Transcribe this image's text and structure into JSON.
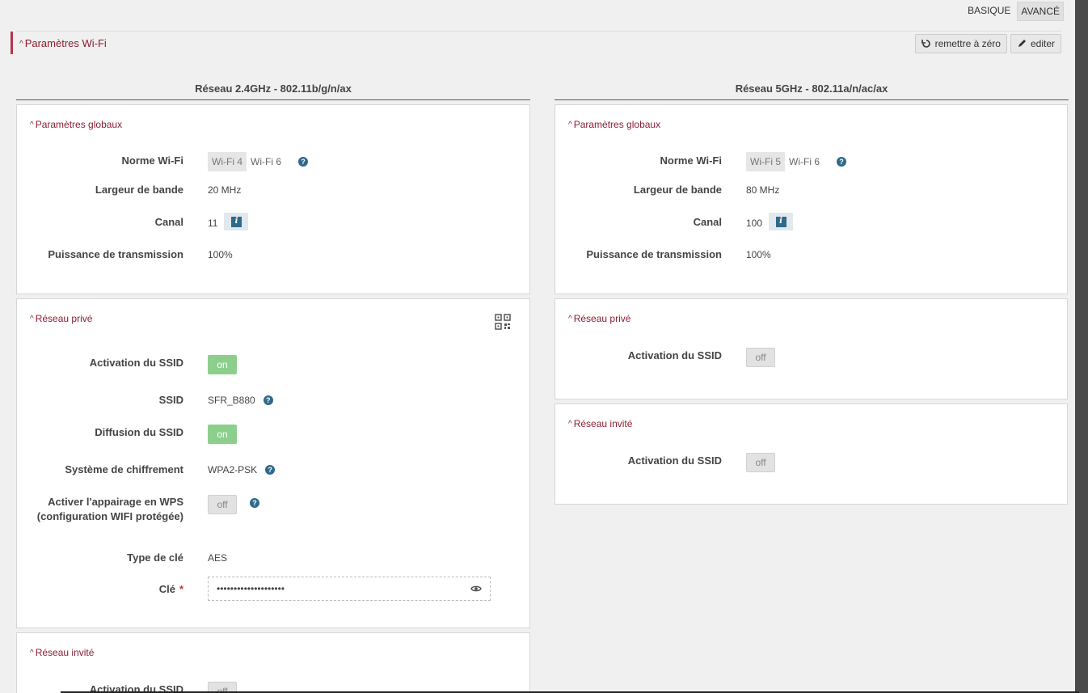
{
  "mode": {
    "basic": "BASIQUE",
    "advanced": "AVANCÉ"
  },
  "section": {
    "title": "Paramètres Wi-Fi",
    "reset_label": "remettre à zéro",
    "edit_label": "editer"
  },
  "left": {
    "column_title": "Réseau 2.4GHz - 802.11b/g/n/ax",
    "global": {
      "title": "Paramètres globaux",
      "norme_label": "Norme Wi-Fi",
      "norme_options": [
        "Wi-Fi 4",
        "Wi-Fi 6"
      ],
      "norme_selected": "Wi-Fi 4",
      "bandwidth_label": "Largeur de bande",
      "bandwidth_value": "20 MHz",
      "channel_label": "Canal",
      "channel_value": "11",
      "power_label": "Puissance de transmission",
      "power_value": "100%"
    },
    "private": {
      "title": "Réseau privé",
      "ssid_activation_label": "Activation du SSID",
      "ssid_activation_value": "on",
      "ssid_label": "SSID",
      "ssid_value": "SFR_B880",
      "broadcast_label": "Diffusion du SSID",
      "broadcast_value": "on",
      "encryption_label": "Système de chiffrement",
      "encryption_value": "WPA2-PSK",
      "wps_label": "Activer l'appairage en WPS (configuration WIFI protégée)",
      "wps_value": "off",
      "keytype_label": "Type de clé",
      "keytype_value": "AES",
      "key_label": "Clé",
      "key_required": "*",
      "key_value": "••••••••••••••••••••"
    },
    "guest": {
      "title": "Réseau invité",
      "ssid_activation_label": "Activation du SSID",
      "ssid_activation_value": "off"
    }
  },
  "right": {
    "column_title": "Réseau 5GHz - 802.11a/n/ac/ax",
    "global": {
      "title": "Paramètres globaux",
      "norme_label": "Norme Wi-Fi",
      "norme_options": [
        "Wi-Fi 5",
        "Wi-Fi 6"
      ],
      "norme_selected": "Wi-Fi 5",
      "bandwidth_label": "Largeur de bande",
      "bandwidth_value": "80 MHz",
      "channel_label": "Canal",
      "channel_value": "100",
      "power_label": "Puissance de transmission",
      "power_value": "100%"
    },
    "private": {
      "title": "Réseau privé",
      "ssid_activation_label": "Activation du SSID",
      "ssid_activation_value": "off"
    },
    "guest": {
      "title": "Réseau invité",
      "ssid_activation_label": "Activation du SSID",
      "ssid_activation_value": "off"
    }
  },
  "icons": {
    "help": "?",
    "info": "i"
  }
}
